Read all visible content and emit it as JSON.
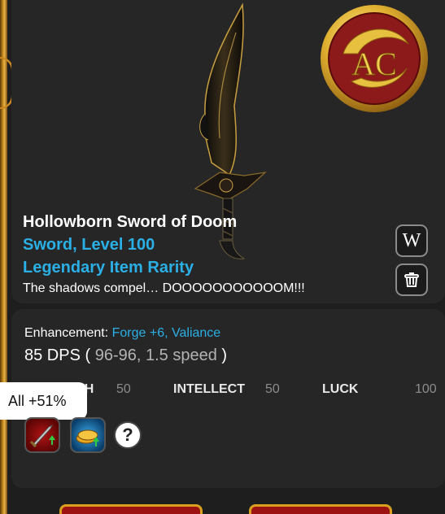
{
  "item": {
    "name": "Hollowborn Sword of Doom",
    "type_level": "Sword, Level 100",
    "rarity": "Legendary Item Rarity",
    "description": "The shadows compel… DOOOOOOOOOOOM!!!"
  },
  "buttons": {
    "wiki_label": "W"
  },
  "enhancement": {
    "label": "Enhancement: ",
    "value": "Forge +6, Valiance"
  },
  "dps": {
    "value": "85 DPS",
    "open": " ( ",
    "detail": "96-96, 1.5 speed",
    "close": " )"
  },
  "stats": [
    {
      "label": "TH",
      "value": "50"
    },
    {
      "label": "INTELLECT",
      "value": "50"
    },
    {
      "label": "LUCK",
      "value": "100"
    }
  ],
  "tooltip": {
    "text": "All +51%"
  },
  "help_label": "?",
  "colors": {
    "accent_blue": "#2ab0e6",
    "card_bg": "#262626",
    "gold": "#d9a020",
    "emblem_red": "#8c1a1a"
  },
  "icons": {
    "wiki": "wiki-w-icon",
    "trash": "trash-icon",
    "boost_damage": "sword-boost-icon",
    "boost_gold": "gold-boost-icon"
  }
}
